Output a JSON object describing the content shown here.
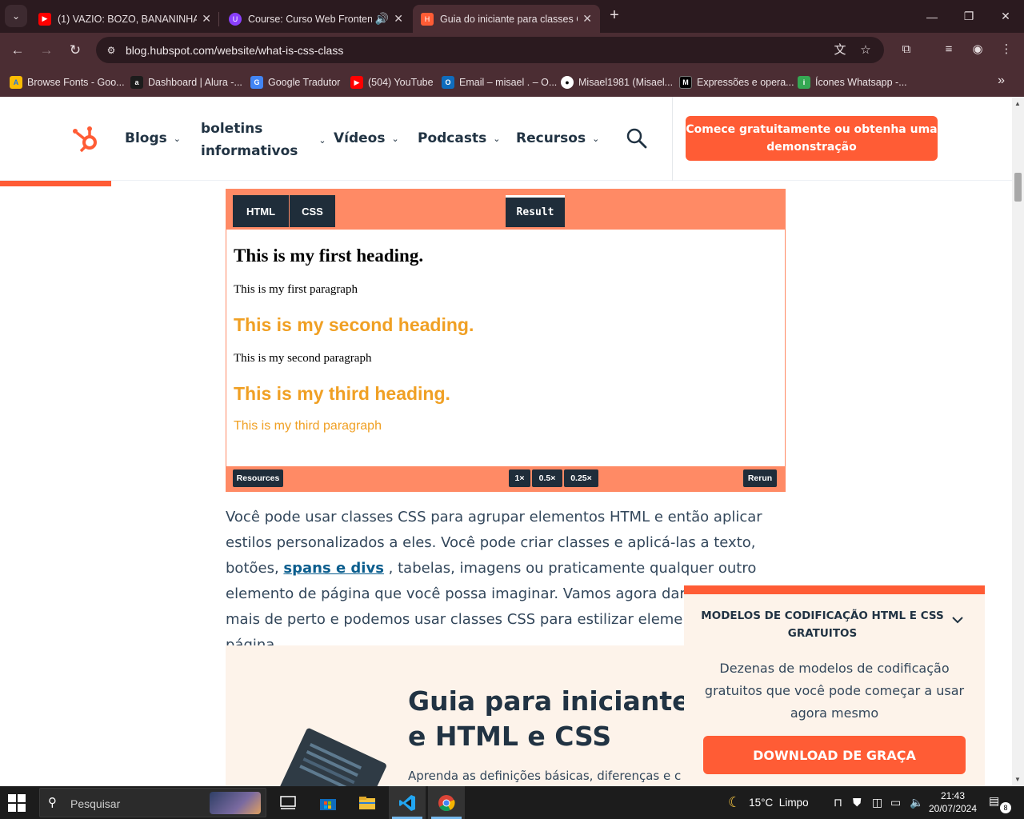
{
  "browser": {
    "tabs": [
      {
        "title": "(1) VAZIO: BOZO, BANANINHA",
        "favicon": "youtube-icon",
        "color": "#ff0000"
      },
      {
        "title": "Course: Curso Web Fronten",
        "favicon": "course-icon",
        "color": "#8a3ffc"
      },
      {
        "title": "Guia do iniciante para classes C",
        "favicon": "hubspot-icon",
        "color": "#ff5c35"
      }
    ],
    "url": "blog.hubspot.com/website/what-is-css-class",
    "bookmarks": [
      {
        "label": "Browse Fonts - Goo...",
        "icon": "google-fonts-icon",
        "color": "#fbbc04"
      },
      {
        "label": "Dashboard | Alura -...",
        "icon": "alura-icon",
        "color": "#1c1c1c"
      },
      {
        "label": "Google Tradutor",
        "icon": "translate-icon",
        "color": "#4285f4"
      },
      {
        "label": "(504) YouTube",
        "icon": "youtube-icon",
        "color": "#ff0000"
      },
      {
        "label": "Email – misael . – O...",
        "icon": "outlook-icon",
        "color": "#0f6cbd"
      },
      {
        "label": "Misael1981 (Misael...",
        "icon": "github-icon",
        "color": "#ffffff"
      },
      {
        "label": "Expressões e opera...",
        "icon": "mdn-icon",
        "color": "#000000"
      },
      {
        "label": "Ícones Whatsapp -...",
        "icon": "icons8-icon",
        "color": "#35a853"
      }
    ]
  },
  "site": {
    "nav": {
      "items": [
        "Blogs",
        "boletins\ninformativos",
        "Vídeos",
        "Podcasts",
        "Recursos"
      ],
      "cta": "Comece gratuitamente ou obtenha uma demonstração"
    },
    "embed": {
      "tabs": [
        "HTML",
        "CSS"
      ],
      "result_tab": "Result",
      "result": {
        "h1": "This is my first heading.",
        "p1": "This is my first paragraph",
        "h2": "This is my second heading.",
        "p2": "This is my second paragraph",
        "h3": "This is my third heading.",
        "p3": "This is my third paragraph"
      },
      "footer": {
        "resources": "Resources",
        "zoom": [
          "1×",
          "0.5×",
          "0.25×"
        ],
        "rerun": "Rerun"
      }
    },
    "article": {
      "p_start": "Você pode usar classes CSS para agrupar elementos HTML e então aplicar estilos personalizados a eles. Você pode criar classes e aplicá-las a texto, botões, ",
      "link": "spans e divs",
      "p_end": " , tabelas, imagens ou praticamente qualquer outro elemento de página que você possa imaginar. Vamos agora dar uma olhada mais de perto e podemos usar classes CSS para estilizar elementos de página."
    },
    "guide": {
      "title": "Guia para iniciantes e HTML e CSS",
      "text": "Aprenda as definições básicas, diferenças e c"
    },
    "popup": {
      "title": "MODELOS DE CODIFICAÇÃO HTML E CSS GRATUITOS",
      "description": "Dezenas de modelos de codificação gratuitos que você pode começar a usar agora mesmo",
      "button": "DOWNLOAD DE GRAÇA"
    }
  },
  "taskbar": {
    "search_placeholder": "Pesquisar",
    "weather": "15°C  Limpo",
    "time": "21:43",
    "date": "20/07/2024",
    "notifications": "8"
  }
}
